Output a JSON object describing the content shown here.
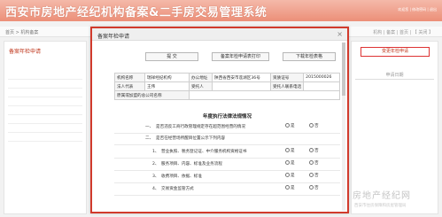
{
  "header": {
    "title": "西安市房地产经纪机构备案&二手房交易管理系统",
    "links": "欢迎您 | 修改密码 | 退出"
  },
  "page": {
    "breadcrumb": "首页 > 机构备案",
    "tabs": "机构 | 备案 | 首页 | 【 关闭 】",
    "side_title": "备案年检申请"
  },
  "right_panel": {
    "button": "变更年检申请",
    "column": "申请日期"
  },
  "modal": {
    "title": "备案年检申请",
    "close": "×",
    "buttons": {
      "submit": "提 交",
      "print_apply": "备案年检申请表打印",
      "download": "下载年检表格"
    }
  },
  "form": {
    "row1": {
      "l1": "机构名称",
      "v1": "瑞祥经纪机构",
      "l2": "办公地址",
      "v2": "陕西省西安市莲湖区36号",
      "l3": "资质证号",
      "v3": "2015000026"
    },
    "row2": {
      "l1": "法人代表",
      "v1": "王伟",
      "l2": "受托人",
      "v2": "",
      "l3": "受托人联系电话",
      "v3": ""
    },
    "row3": {
      "l1": "原属或加盟的总公司名称",
      "v1": ""
    }
  },
  "section": {
    "title": "年度执行法律法规情况",
    "items": [
      {
        "no": "一、",
        "text": "是否违反工商行政管理规定存在超范围经营的情况",
        "yes": "是",
        "no_opt": "否"
      },
      {
        "no": "二、",
        "text": "是否在经营场所醒目位置公示下列内容",
        "yes": "",
        "no_opt": ""
      },
      {
        "no": "1、",
        "text": "营业执照、税务登记证、中介服务机构资格证书",
        "yes": "是",
        "no_opt": "否"
      },
      {
        "no": "2、",
        "text": "服务项目、内容、标准及业务流程",
        "yes": "是",
        "no_opt": "否"
      },
      {
        "no": "3、",
        "text": "收费项目、依据、标准",
        "yes": "是",
        "no_opt": "否"
      },
      {
        "no": "4、",
        "text": "交易资金监管方式",
        "yes": "是",
        "no_opt": "否"
      }
    ]
  },
  "footer": "技术支持：西安市房地产交易管理服务中心   Copyright © 2015",
  "watermark": "房地产经纪网",
  "watermark2": "西安市住房保障和房屋管理局"
}
